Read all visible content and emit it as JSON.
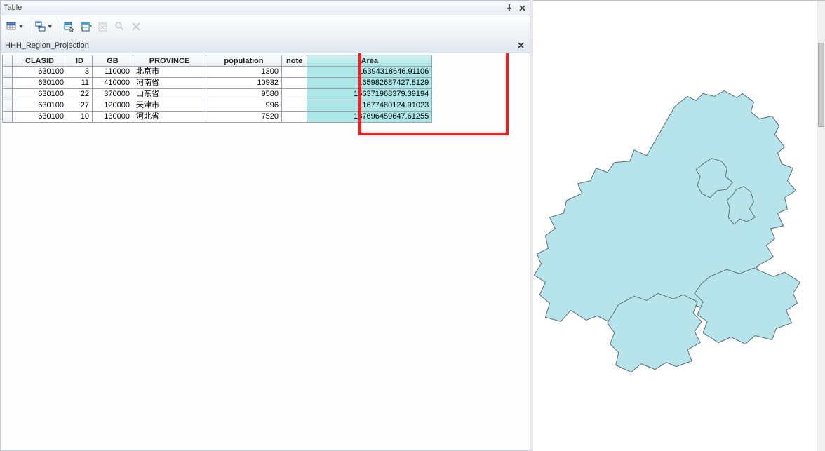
{
  "panel": {
    "title": "Table",
    "subtitle": "HHH_Region_Projection"
  },
  "columns": [
    "CLASID",
    "ID",
    "GB",
    "PROVINCE",
    "population",
    "note",
    "Area"
  ],
  "rows": [
    {
      "clasid": "630100",
      "id": "3",
      "gb": "110000",
      "province": "北京市",
      "population": "1300",
      "note": "",
      "area": "16394318646.91106"
    },
    {
      "clasid": "630100",
      "id": "11",
      "gb": "410000",
      "province": "河南省",
      "population": "10932",
      "note": "",
      "area": "165982687427.8129"
    },
    {
      "clasid": "630100",
      "id": "22",
      "gb": "370000",
      "province": "山东省",
      "population": "9580",
      "note": "",
      "area": "156371968379.39194"
    },
    {
      "clasid": "630100",
      "id": "27",
      "gb": "120000",
      "province": "天津市",
      "population": "996",
      "note": "",
      "area": "11677480124.91023"
    },
    {
      "clasid": "630100",
      "id": "10",
      "gb": "130000",
      "province": "河北省",
      "population": "7520",
      "note": "",
      "area": "187696459647.61255"
    }
  ],
  "colors": {
    "accent": "#aee7e7",
    "highlight": "#ff1a1a",
    "map_fill": "#b6e4ea",
    "map_stroke": "#5a6d78"
  }
}
